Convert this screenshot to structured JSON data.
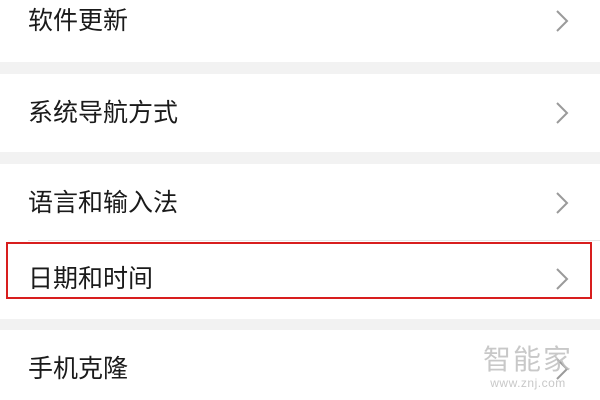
{
  "settings": {
    "items": [
      {
        "label": "软件更新",
        "chevron_icon": "chevron-right-icon"
      },
      {
        "label": "系统导航方式",
        "chevron_icon": "chevron-right-icon"
      },
      {
        "label": "语言和输入法",
        "chevron_icon": "chevron-right-icon"
      },
      {
        "label": "日期和时间",
        "chevron_icon": "chevron-right-icon",
        "highlighted": true
      },
      {
        "label": "手机克隆",
        "chevron_icon": "chevron-right-icon"
      }
    ]
  },
  "highlight": {
    "color": "#d81e1e"
  },
  "watermark": {
    "title": "智能家",
    "url": "www.znj.com"
  }
}
